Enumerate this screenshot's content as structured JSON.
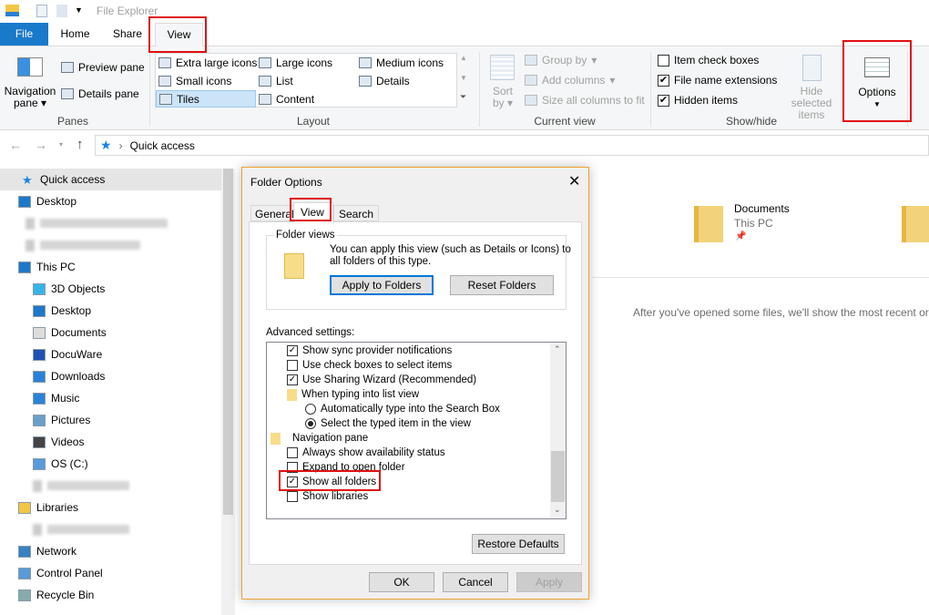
{
  "window": {
    "title": "File Explorer"
  },
  "tabs": [
    {
      "label": "File"
    },
    {
      "label": "Home"
    },
    {
      "label": "Share"
    },
    {
      "label": "View"
    }
  ],
  "ribbon": {
    "panes": {
      "nav": "Navigation",
      "nav2": "pane",
      "preview": "Preview pane",
      "details": "Details pane",
      "group": "Panes"
    },
    "layout": {
      "items": [
        "Extra large icons",
        "Large icons",
        "Medium icons",
        "Small icons",
        "List",
        "Details",
        "Tiles",
        "Content"
      ],
      "selected": "Tiles",
      "group": "Layout"
    },
    "current_view": {
      "sort": "Sort",
      "sort2": "by",
      "group_by": "Group by",
      "add_columns": "Add columns",
      "size_all": "Size all columns to fit",
      "group": "Current view"
    },
    "show_hide": {
      "items": [
        {
          "label": "Item check boxes",
          "checked": false
        },
        {
          "label": "File name extensions",
          "checked": true
        },
        {
          "label": "Hidden items",
          "checked": true
        }
      ],
      "hide_selected": "Hide selected",
      "hide_selected2": "items",
      "group": "Show/hide"
    },
    "options": "Options"
  },
  "address": {
    "path": "Quick access"
  },
  "sidebar": {
    "items": [
      "Quick access",
      "Desktop",
      "",
      "",
      "This PC",
      "3D Objects",
      "Desktop",
      "Documents",
      "DocuWare",
      "Downloads",
      "Music",
      "Pictures",
      "Videos",
      "OS (C:)",
      "",
      "Libraries",
      "",
      "Network",
      "Control Panel",
      "Recycle Bin"
    ]
  },
  "main": {
    "tile_name": "Documents",
    "tile_sub": "This PC",
    "recent_text": "After you've opened some files, we'll show the most recent or"
  },
  "dialog": {
    "title": "Folder Options",
    "tabs": [
      "General",
      "View",
      "Search"
    ],
    "folder_views": {
      "legend": "Folder views",
      "text1": "You can apply this view (such as Details or Icons) to",
      "text2": "all folders of this type.",
      "apply": "Apply to Folders",
      "reset": "Reset Folders"
    },
    "advanced_label": "Advanced settings:",
    "settings": [
      {
        "label": "Show sync provider notifications",
        "type": "check",
        "checked": true
      },
      {
        "label": "Use check boxes to select items",
        "type": "check",
        "checked": false
      },
      {
        "label": "Use Sharing Wizard (Recommended)",
        "type": "check",
        "checked": true
      },
      {
        "label": "When typing into list view",
        "type": "folder"
      },
      {
        "label": "Automatically type into the Search Box",
        "type": "radio",
        "checked": false
      },
      {
        "label": "Select the typed item in the view",
        "type": "radio",
        "checked": true
      },
      {
        "label": "Navigation pane",
        "type": "navfolder"
      },
      {
        "label": "Always show availability status",
        "type": "check",
        "checked": false
      },
      {
        "label": "Expand to open folder",
        "type": "check",
        "checked": false
      },
      {
        "label": "Show all folders",
        "type": "check",
        "checked": true
      },
      {
        "label": "Show libraries",
        "type": "check",
        "checked": false
      }
    ],
    "restore": "Restore Defaults",
    "ok": "OK",
    "cancel": "Cancel",
    "apply": "Apply"
  }
}
